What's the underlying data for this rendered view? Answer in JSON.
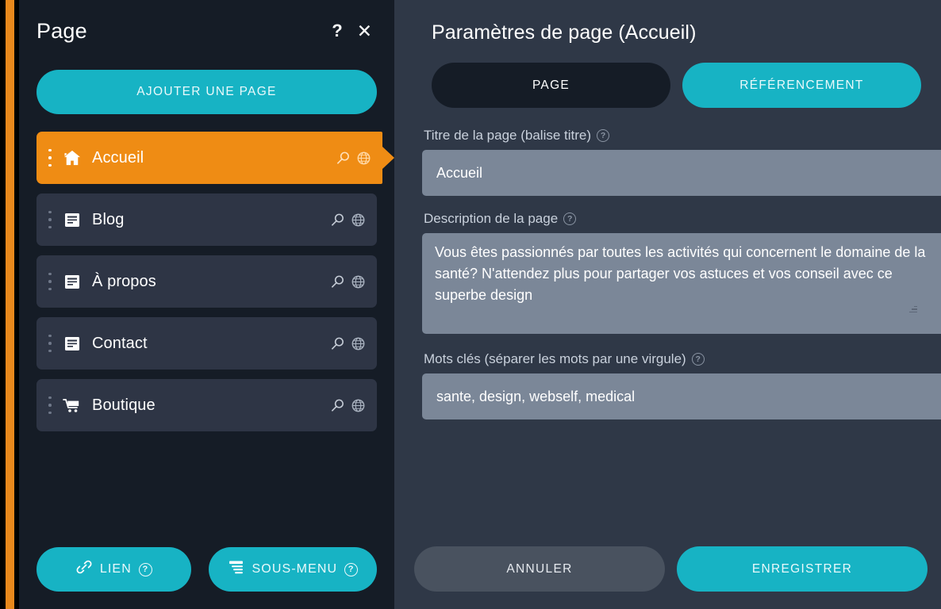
{
  "theme": {
    "accent_cyan": "#17b3c4",
    "accent_orange": "#ef8c14",
    "left_panel_bg": "#151c26",
    "right_panel_bg": "#2f3847",
    "list_item_bg": "#2e3545",
    "input_bg": "#7b8798",
    "cancel_bg": "#49525f"
  },
  "left": {
    "title": "Page",
    "help_icon": "?",
    "close_icon": "✕",
    "add_page_label": "AJOUTER UNE PAGE",
    "pages": [
      {
        "label": "Accueil",
        "icon": "home-icon",
        "active": true
      },
      {
        "label": "Blog",
        "icon": "document-icon",
        "active": false
      },
      {
        "label": "À propos",
        "icon": "document-icon",
        "active": false
      },
      {
        "label": "Contact",
        "icon": "document-icon",
        "active": false
      },
      {
        "label": "Boutique",
        "icon": "cart-icon",
        "active": false
      }
    ],
    "row_tools": {
      "seo_icon": "magnifier-icon",
      "globe_icon": "globe-icon"
    },
    "footer": {
      "link_label": "LIEN",
      "link_icon": "chain-link-icon",
      "link_help": "?",
      "submenu_label": "SOUS-MENU",
      "submenu_icon": "submenu-icon",
      "submenu_help": "?"
    }
  },
  "right": {
    "title": "Paramètres de page (Accueil)",
    "tabs": [
      {
        "label": "PAGE",
        "active": false
      },
      {
        "label": "RÉFÉRENCEMENT",
        "active": true
      }
    ],
    "fields": {
      "title": {
        "label": "Titre de la page (balise titre)",
        "help": "?",
        "value": "Accueil",
        "placeholder": "Titre de la page"
      },
      "description": {
        "label": "Description de la page",
        "help": "?",
        "value": "Vous êtes passionnés par toutes les activités qui concernent le domaine de la santé? N'attendez plus pour partager vos astuces et vos conseil avec ce superbe design",
        "placeholder": "Description de la page"
      },
      "keywords": {
        "label": "Mots clés (séparer les mots par une virgule)",
        "help": "?",
        "value": "sante, design, webself, medical",
        "placeholder": "Mots clés"
      }
    },
    "footer": {
      "cancel_label": "ANNULER",
      "save_label": "ENREGISTRER"
    }
  }
}
